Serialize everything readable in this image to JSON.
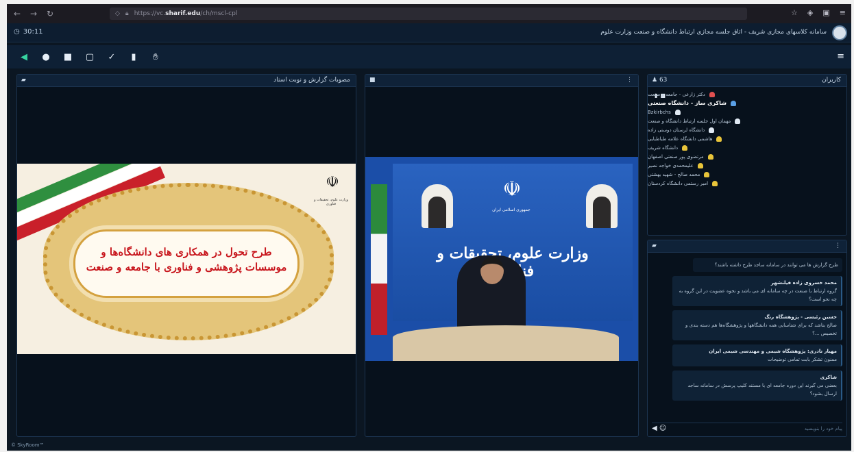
{
  "browser": {
    "url_prefix": "https://vc.",
    "url_domain": "sharif.edu",
    "url_path": "/ch/mscl-cpl",
    "icons": [
      "back-icon",
      "forward-icon",
      "reload-icon",
      "shield-icon",
      "lock-icon",
      "star-icon",
      "extension-icon",
      "menu-icon"
    ]
  },
  "app": {
    "clock": "30:11",
    "title": "سامانه کلاسهای مجازی شریف - اتاق جلسه مجازی ارتباط دانشگاه و صنعت وزارت علوم",
    "footer": "© SkyRoom™"
  },
  "toolbar": {
    "items": [
      "speaker-icon",
      "microphone-icon",
      "camera-icon",
      "screen-share-icon",
      "pen-icon",
      "file-icon",
      "hand-raise-icon"
    ],
    "menu": "≡"
  },
  "presentation": {
    "header_title": "مصوبات گزارش و نوبت اسناد",
    "slide_line1": "طرح تحول در همکاری های دانشگاه‌ها و",
    "slide_line2": "موسسات پژوهشی و فناوری با جامعه و صنعت",
    "emblem_caption": "وزارت علوم، تحقیقات و فناوری"
  },
  "video": {
    "ministry_text": "وزارت علوم، تحقیقات و فناوری",
    "backdrop_caption": "جمهوری اسلامی ایران"
  },
  "participants": {
    "header_title": "کاربران",
    "count": "63",
    "list": [
      {
        "name": "دکتر زارعی - جامعه و صنعت",
        "color": "#e05050",
        "bold": false
      },
      {
        "name": "شاکری ساز - دانشگاه صنعتی",
        "color": "#5aa0e6",
        "bold": true
      },
      {
        "name": "Bzkirbchs",
        "color": "#dfe8f2",
        "bold": false
      },
      {
        "name": "مهمان اول جلسه ارتباط دانشگاه و صنعت",
        "color": "#dfe8f2",
        "bold": false
      },
      {
        "name": "دانشگاه لرستان دوستی زاده",
        "color": "#dfe8f2",
        "bold": false
      },
      {
        "name": "هاشمی دانشگاه علامه طباطبایی",
        "color": "#e8c43a",
        "bold": false
      },
      {
        "name": "دانشگاه شریف",
        "color": "#e8c43a",
        "bold": false
      },
      {
        "name": "مرتضوی پور صنعتی اصفهان",
        "color": "#e8c43a",
        "bold": false
      },
      {
        "name": "علیمحمدی خواجه نصیر",
        "color": "#e8c43a",
        "bold": false
      },
      {
        "name": "محمد صالح - شهید بهشتی",
        "color": "#e8c43a",
        "bold": false
      },
      {
        "name": "امیر رستمی دانشگاه کردستان",
        "color": "#e8c43a",
        "bold": false
      }
    ]
  },
  "chat": {
    "messages": [
      {
        "who": "",
        "text": "طرح گزارش ها می توانند در سامانه ساجد طرح داشته باشند؟"
      },
      {
        "who": "محمد خسروی زاده فیلنشهر",
        "text": "گروه ارتباط با صنعت در چه سامانه ای می باشد و نحوه عضویت در این گروه به چه نحو است؟"
      },
      {
        "who": "حسین رئیسی - پژوهشگاه رنگ",
        "text": "صالح بناشد که برای شناسایی همه دانشگاهها و پژوهشگاه‌ها هم دسته بندی و تخصیص ...؟"
      },
      {
        "who": "مهیار نادری: پژوهشگاه شیمی و مهندسی شیمی ایران",
        "text": "ممنون تشکر بابت تمامی توضیحات"
      },
      {
        "who": "شاکری",
        "text": "بعضی می گیرند این دوره جامعه ای با مستند کلیپ پرسش در سامانه ساجد ارسال بشود؟"
      }
    ],
    "placeholder": "پیام خود را بنویسید"
  }
}
